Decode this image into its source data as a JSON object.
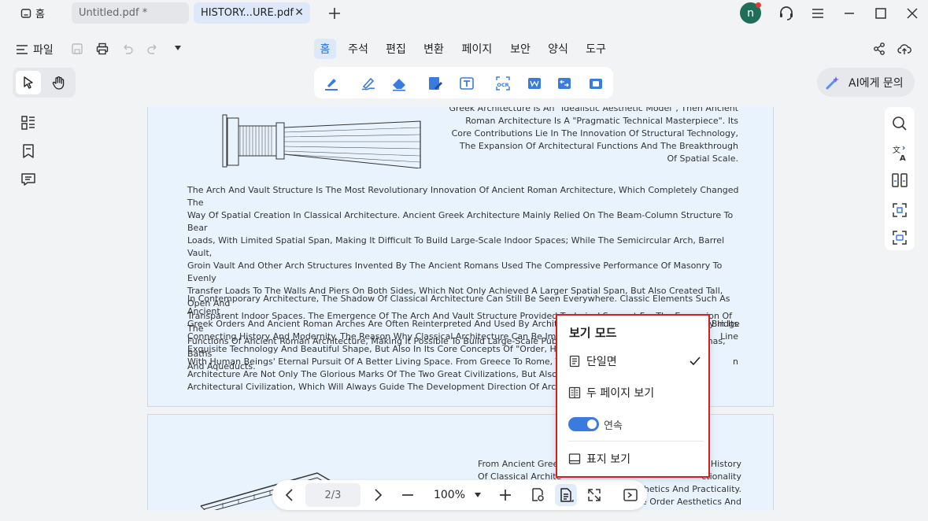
{
  "tabs": {
    "home_label": "홈",
    "untitled_label": "Untitled.pdf *",
    "active_label": "HISTORY...URE.pdf"
  },
  "user": {
    "avatar_letter": "n"
  },
  "file_menu_label": "파일",
  "menu_tabs": [
    "홈",
    "주석",
    "편집",
    "변환",
    "페이지",
    "보안",
    "양식",
    "도구"
  ],
  "ai_button_label": "AI에게 문의",
  "document": {
    "p1_right_text": [
      "Greek Architecture Is An \"Idealistic Aesthetic Model\", Then Ancient",
      "Roman Architecture Is A \"Pragmatic Technical Masterpiece\". Its",
      "Core Contributions Lie In The Innovation Of Structural Technology,",
      "The Expansion Of Architectural Functions And The Breakthrough",
      "Of Spatial Scale."
    ],
    "p1_para1": [
      "The Arch And Vault Structure Is The Most Revolutionary Innovation Of Ancient Roman Architecture, Which Completely Changed The",
      "Way Of Spatial Creation In Classical Architecture. Ancient Greek Architecture Mainly Relied On The Beam-Column Structure To Bear",
      "Loads, With Limited Spatial Span, Making It Difficult To Build Large-Scale Indoor Spaces; While The Semicircular Arch, Barrel Vault,",
      "Groin Vault And Other Arch Structures Invented By The Ancient Romans Used The Compressive Performance Of Masonry To Evenly",
      "Transfer Loads To The Walls And Piers On Both Sides, Which Not Only Achieved A Larger Spatial Span, But Also Created Tall, Open And",
      "Transparent Indoor Spaces. The Emergence Of The Arch And Vault Structure Provided Technical Support For The Expansion Of The",
      "Functions Of Ancient Roman Architecture, Making It Possible To Build Large-Scale Public Buildings Such As Theaters, Arenas, Baths",
      "And Aqueducts."
    ],
    "p1_para2": [
      "In Contemporary Architecture, The Shadow Of Classical Architecture Can Still Be Seen Everywhere. Classic Elements Such As Ancient",
      "Greek Orders And Ancient Roman Arches Are Often Reinterpreted And Used By Architects In A Modern Way, Becoming A Bridge",
      "Connecting History And Modernity. The Reason Why Classical Architecture Can Be Immort",
      "Exquisite Technology And Beautiful Shape, But Also In Its Core Concepts Of \"Order, Harmc",
      "With Human Beings' Eternal Pursuit Of A Better Living Space. From Greece To Rome, The In",
      "Architecture Are Not Only The Glorious Marks Of The Two Great Civilizations, But Also A Pr",
      "Architectural Civilization, Which Will Always Guide The Development Direction Of Architec"
    ],
    "p1_para2_right": [
      "ly In Its",
      "Line",
      "n"
    ],
    "p2_left_text": [
      "From Ancient Gree",
      "Of Classical Archite"
    ],
    "p2_right_text": [
      "History",
      "ctionality",
      "hetics And Practicality.",
      "e Order Aesthetics And"
    ]
  },
  "bottom_nav": {
    "page_indicator": "2/3",
    "zoom": "100%"
  },
  "view_mode_popup": {
    "title": "보기 모드",
    "single_page": "단일면",
    "two_page": "두 페이지 보기",
    "continuous": "연속",
    "cover_view": "표지 보기",
    "continuous_on": true,
    "selected": "단일면"
  },
  "colors": {
    "accent": "#2f6fd6",
    "popup_border": "#d31f24",
    "page_bg": "#e9f3fd",
    "avatar_bg": "#1f6e5a"
  }
}
